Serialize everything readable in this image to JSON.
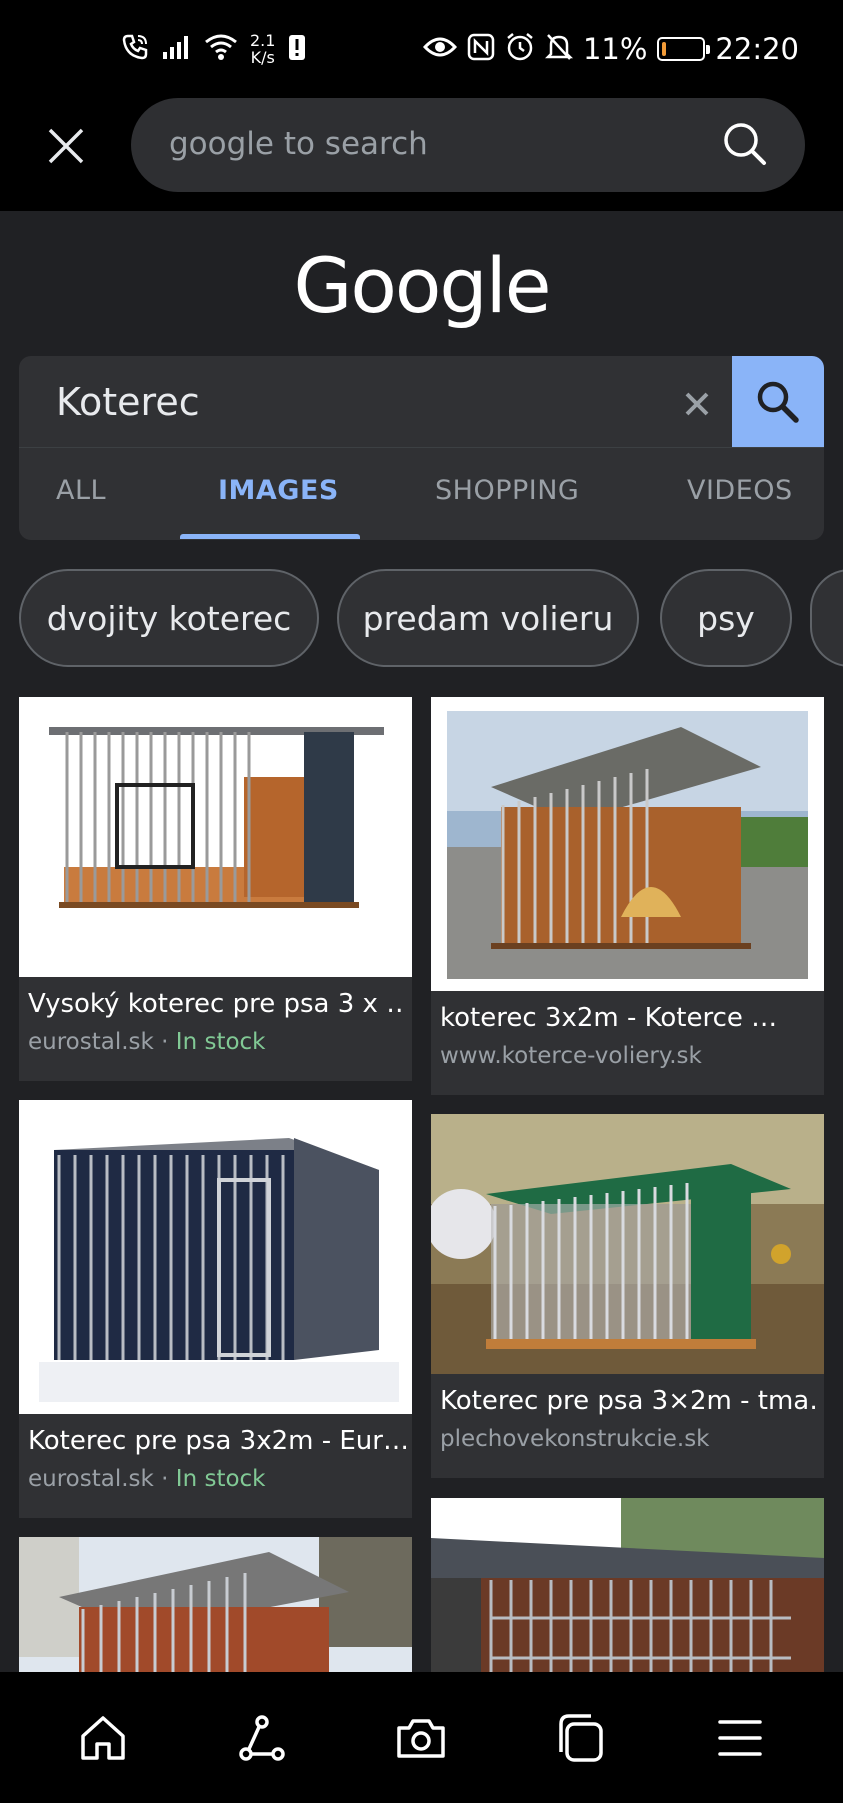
{
  "status_bar": {
    "net_speed_value": "2.1",
    "net_speed_unit": "K/s",
    "battery_percent": "11%",
    "battery_level": 0.11,
    "time": "22:20",
    "icons": [
      "wifi-call-icon",
      "signal-icon",
      "wifi-icon",
      "alert-icon",
      "eye-icon",
      "nfc-icon",
      "alarm-icon",
      "mute-icon",
      "battery-icon"
    ]
  },
  "browser": {
    "search_placeholder": "google to search"
  },
  "google": {
    "logo_text": "Google",
    "query": "Koterec",
    "tabs": [
      {
        "label": "ALL",
        "active": false
      },
      {
        "label": "IMAGES",
        "active": true
      },
      {
        "label": "SHOPPING",
        "active": false
      },
      {
        "label": "VIDEOS",
        "active": false
      }
    ],
    "chips": [
      {
        "label": "dvojity koterec"
      },
      {
        "label": "predam volieru"
      },
      {
        "label": "psy"
      }
    ]
  },
  "results": [
    {
      "title": "Vysoký koterec pre psa 3 x …",
      "source": "eurostal.sk",
      "separator": " · ",
      "stock": "In stock"
    },
    {
      "title": "koterec 3x2m - Koterce …",
      "source": "www.koterce-voliery.sk",
      "separator": "",
      "stock": ""
    },
    {
      "title": "Koterec pre psa 3x2m - Eur…",
      "source": "eurostal.sk",
      "separator": " · ",
      "stock": "In stock"
    },
    {
      "title": "Koterec pre psa 3×2m - tma…",
      "source": "plechovekonstrukcie.sk",
      "separator": "",
      "stock": ""
    }
  ],
  "colors": {
    "accent": "#8ab4f8",
    "background": "#202124",
    "surface": "#303134",
    "stock_green": "#81c995",
    "battery_orange": "#f29b38"
  },
  "bottom_nav": {
    "icons": [
      "home-icon",
      "share-icon",
      "camera-icon",
      "tabs-icon",
      "menu-icon"
    ]
  }
}
